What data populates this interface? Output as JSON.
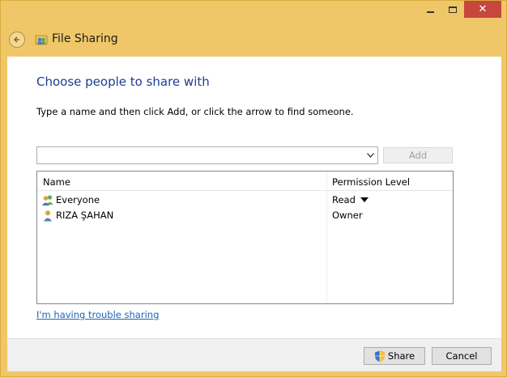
{
  "window": {
    "title": "File Sharing"
  },
  "content": {
    "heading": "Choose people to share with",
    "instructions": "Type a name and then click Add, or click the arrow to find someone.",
    "name_input": {
      "value": "",
      "placeholder": ""
    },
    "add_label": "Add",
    "list": {
      "columns": {
        "name": "Name",
        "permission": "Permission Level"
      },
      "rows": [
        {
          "name": "Everyone",
          "permission": "Read",
          "icon": "group-icon"
        },
        {
          "name": "RIZA ŞAHAN",
          "permission": "Owner",
          "icon": "user-icon"
        }
      ]
    },
    "trouble_link": "I'm having trouble sharing"
  },
  "footer": {
    "share_label": "Share",
    "cancel_label": "Cancel"
  },
  "colors": {
    "frame": "#f0c768",
    "heading": "#1f3d8f",
    "link": "#1e64b4",
    "close": "#c7463d"
  }
}
